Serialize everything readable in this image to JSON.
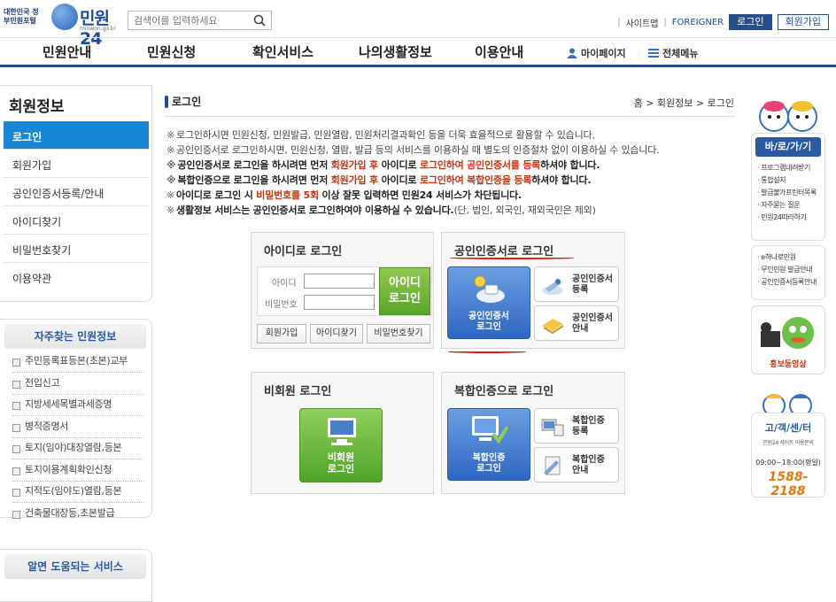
{
  "header": {
    "gov_label": "대한민국 정부민원포털",
    "logo_name": "민원24",
    "logo_domain": "minwon.go.kr",
    "search_placeholder": "검색어를 입력하세요",
    "links": {
      "sitemap": "사이트맵",
      "foreigner": "FOREIGNER"
    },
    "login_button": "로그인",
    "join_button": "회원가입"
  },
  "gnb": {
    "items": [
      "민원안내",
      "민원신청",
      "확인서비스",
      "나의생활정보",
      "이용안내"
    ],
    "mypage": "마이페이지",
    "allmenu": "전체메뉴"
  },
  "lnb": {
    "title": "회원정보",
    "items": [
      "로그인",
      "회원가입",
      "공인인증서등록/안내",
      "아이디찾기",
      "비밀번호찾기",
      "이용약관"
    ]
  },
  "faq": {
    "title": "자주찾는 민원정보",
    "items": [
      "주민등록표등본(초본)교부",
      "전입신고",
      "지방세세목별과세증명",
      "병적증명서",
      "토지(임야)대장열람,등본",
      "토지이용계획확인신청",
      "지적도(임야도)열람,등본",
      "건축물대장등,초본발급"
    ]
  },
  "help": {
    "title": "알면 도움되는 서비스"
  },
  "content": {
    "title": "로그인",
    "breadcrumb": {
      "home": "홈",
      "sep": ">",
      "section": "회원정보",
      "page": "로그인"
    },
    "notes": [
      {
        "pre": "로그인하시면 민원신청, 민원발급, 민원열람, 민원처리결과확인 등을 더욱 효율적으로 활용할 수 있습니다.",
        "red": "",
        "mid": "",
        "red2": "",
        "post": ""
      },
      {
        "pre": "공인인증서로 로그인하시면, 민원신청, 열람, 발급 등의 서비스를 이용하실 때 별도의 인증절차 없이 이용하실 수 있습니다.",
        "red": "",
        "mid": "",
        "red2": "",
        "post": ""
      },
      {
        "pre": "공인인증서로 로그인을 하시려면 먼저 ",
        "red": "회원가입 후",
        "mid": " 아이디로 ",
        "red2": "로그인하여 공인인증서를 등록",
        "post": "하셔야 합니다."
      },
      {
        "pre": "복합인증으로 로그인을 하시려면 먼저 ",
        "red": "회원가입 후",
        "mid": " 아이디로 ",
        "red2": "로그인하여 복합인증을 등록",
        "post": "하셔야 합니다."
      },
      {
        "pre": "아이디로 로그인 시 ",
        "red": "비밀번호를 5회",
        "mid": " 이상 잘못 입력하면 민원24 서비스가 차단됩니다.",
        "red2": "",
        "post": ""
      },
      {
        "pre": "생활정보 서비스는 공인인증서로 로그인하여야 이용하실 수 있습니다.",
        "red": "",
        "mid": "(단, 법인, 외국인, 재외국민은 제외)",
        "red2": "",
        "post": ""
      }
    ]
  },
  "panels": {
    "id_login": {
      "title": "아이디로 로그인",
      "id_label": "아이디",
      "pw_label": "비밀번호",
      "login_button": [
        "아이디",
        "로그인"
      ],
      "join": "회원가입",
      "find_id": "아이디찾기",
      "find_pw": "비밀번호찾기"
    },
    "cert_login": {
      "title": "공인인증서로 로그인",
      "main_button": [
        "공인인증서",
        "로그인"
      ],
      "register": [
        "공인인증서",
        "등록"
      ],
      "guide": [
        "공인인증서",
        "안내"
      ]
    },
    "guest_login": {
      "title": "비회원 로그인",
      "button": [
        "비회원",
        "로그인"
      ]
    },
    "multi_login": {
      "title": "복합인증으로 로그인",
      "main_button": [
        "복합인증",
        "로그인"
      ],
      "register": [
        "복합인증",
        "등록"
      ],
      "guide": [
        "복합인증",
        "안내"
      ]
    }
  },
  "quick": {
    "title": "바/로/가/기",
    "links": [
      "프로그램내려받기",
      "통합설치",
      "발급불가프린터목록",
      "자주묻는 질문",
      "민원24따라하기"
    ],
    "links2": [
      "e하나로민원",
      "무인민원 발급안내",
      "공인인증서등록안내"
    ],
    "promo": "홍보동영상",
    "call_title": "고/객/센/터",
    "call_sub": "민원24 사이트 이용문의",
    "call_hours": "09:00~18:00(평일)",
    "call_number": "1588-2188"
  },
  "colors": {
    "brand": "#1a4c9c",
    "active": "#1a87d6",
    "alert": "#c8340c",
    "green": "#5aa42a"
  }
}
